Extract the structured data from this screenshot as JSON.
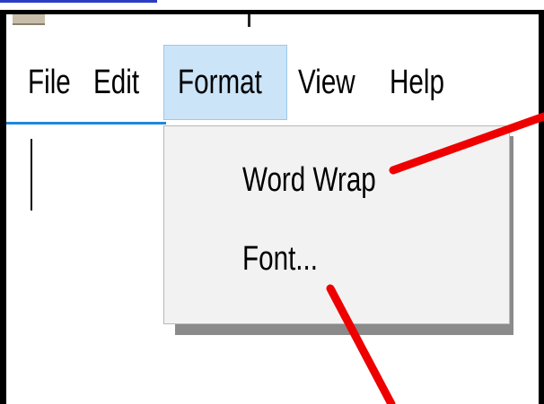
{
  "menubar": {
    "items": [
      {
        "label": "File"
      },
      {
        "label": "Edit"
      },
      {
        "label": "Format"
      },
      {
        "label": "View"
      },
      {
        "label": "Help"
      }
    ]
  },
  "format_menu": {
    "items": [
      {
        "label": "Word Wrap"
      },
      {
        "label": "Font..."
      }
    ]
  },
  "colors": {
    "menu_highlight": "#cce4f7",
    "annotation_arrow": "#ee0000"
  }
}
